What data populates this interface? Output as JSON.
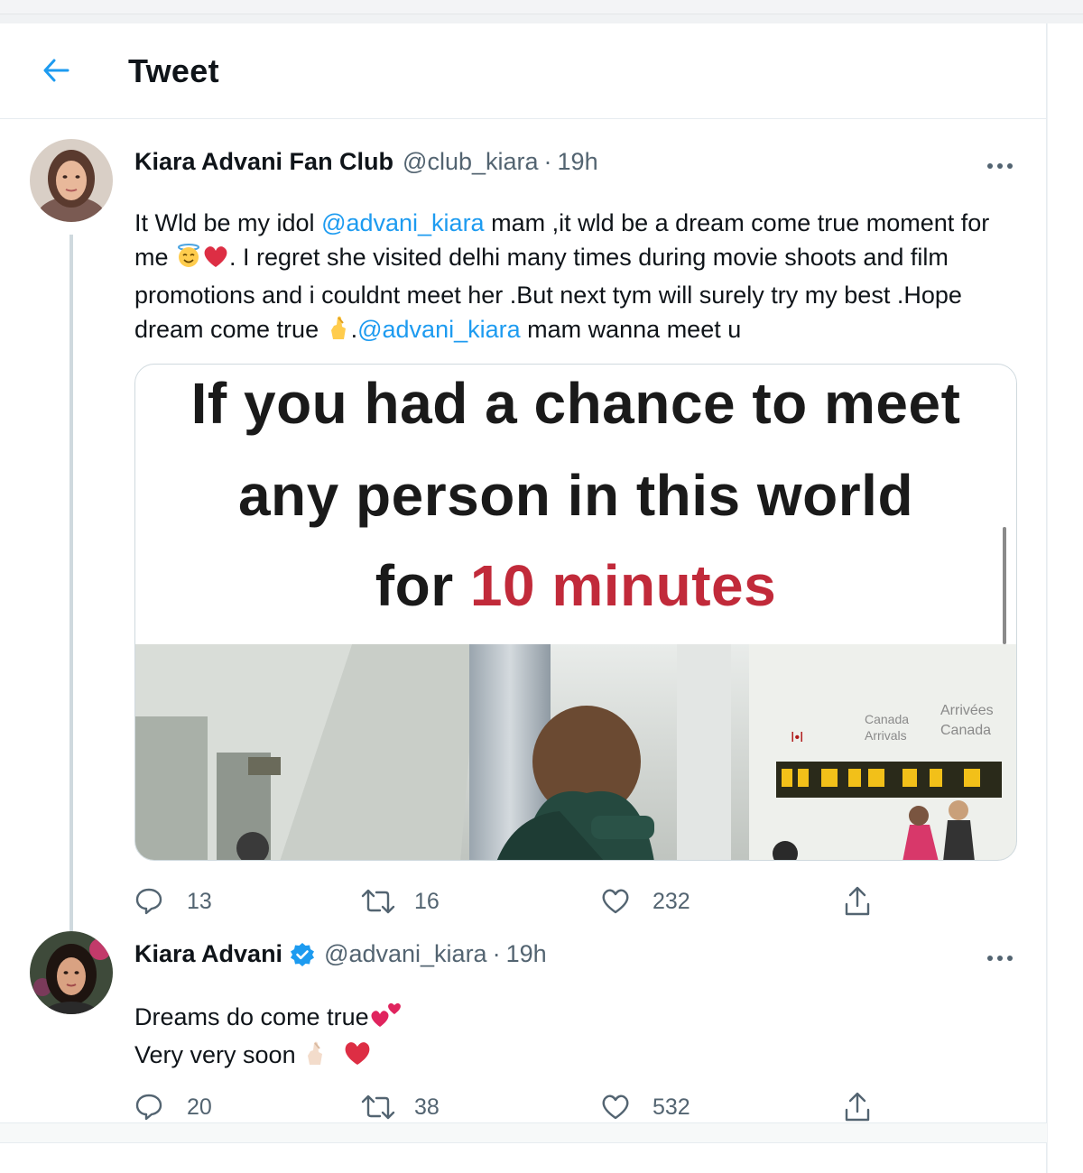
{
  "header": {
    "back_icon": "arrow-left-icon",
    "title": "Tweet",
    "accent": "#1d9bf0"
  },
  "tweets": [
    {
      "display_name": "Kiara Advani Fan Club",
      "handle": "@club_kiara",
      "separator": "·",
      "time": "19h",
      "more_icon": "more-dots-icon",
      "text_parts": {
        "p1": "It Wld be my idol ",
        "m1": "@advani_kiara",
        "p2": " mam ,it wld be a dream come true moment for me ",
        "p3": ". I regret she visited delhi many times during movie shoots and film promotions and i couldnt meet her .But next tym will surely try my best .Hope dream come true ",
        "p4": ".",
        "m2": "@advani_kiara",
        "p5": " mam wanna meet u"
      },
      "media": {
        "line1": "If you had a chance to meet",
        "line2": "any person in this world",
        "line3_prefix": "for ",
        "line3_highlight": "10 minutes",
        "sign_canada": "Canada",
        "sign_arrivals": "Arrivals",
        "sign_arrivees": "Arrivées",
        "sign_canada_fr": "Canada"
      },
      "actions": {
        "reply_count": "13",
        "retweet_count": "16",
        "like_count": "232"
      }
    },
    {
      "display_name": "Kiara Advani",
      "verified": true,
      "handle": "@advani_kiara",
      "separator": "·",
      "time": "19h",
      "more_icon": "more-dots-icon",
      "text_line1": "Dreams do come true",
      "text_line2": "Very very soon",
      "actions": {
        "reply_count": "20",
        "retweet_count": "38",
        "like_count": "532"
      }
    }
  ]
}
